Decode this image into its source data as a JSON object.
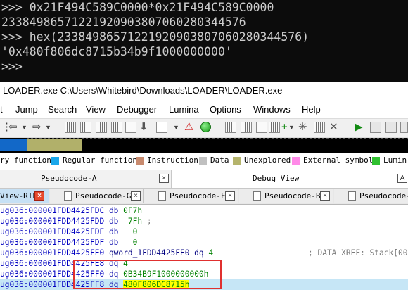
{
  "terminal": {
    "lines": [
      ">>> 0x21F494C589C0000*0x21F494C589C0000",
      "23384986571221920903807060280344576",
      ">>> hex(23384986571221920903807060280344576)",
      "'0x480f806dc8715b34b9f1000000000'",
      ">>>"
    ],
    "bg": "#0c0c0c",
    "fg": "#cccccc"
  },
  "window": {
    "title": "LOADER.exe C:\\Users\\Whitebird\\Downloads\\LOADER\\LOADER.exe"
  },
  "menu": {
    "items": [
      "t",
      "Jump",
      "Search",
      "View",
      "Debugger",
      "Lumina",
      "Options",
      "Windows",
      "Help"
    ]
  },
  "toolbar": {
    "icons": [
      "back-arrow-icon",
      "forward-arrow-icon",
      "hex-view-icon",
      "jump-down-icon",
      "warning-icon",
      "record-icon",
      "step-into-icon",
      "step-over-icon",
      "play-icon",
      "pause-icon",
      "stop-icon"
    ]
  },
  "legend": {
    "items": [
      {
        "label": "ry function",
        "color": "#1fa3d8"
      },
      {
        "label": "Regular function",
        "color": "#1aa7ea"
      },
      {
        "label": "Instruction",
        "color": "#c88a6e"
      },
      {
        "label": "Data",
        "color": "#c0c0c0"
      },
      {
        "label": "Unexplored",
        "color": "#b5b46c"
      },
      {
        "label": "External symbol",
        "color": "#ff8ae8"
      },
      {
        "label": "Lumin",
        "color": "#30c030"
      }
    ]
  },
  "top_tabs": [
    {
      "label": "Pseudocode-A"
    },
    {
      "label": "Debug View"
    }
  ],
  "sub_tabs": [
    {
      "label": "View-RIP"
    },
    {
      "label": "Pseudocode-G"
    },
    {
      "label": "Pseudocode-F"
    },
    {
      "label": "Pseudocode-B"
    },
    {
      "label": "Pseudocode-E"
    }
  ],
  "code": {
    "lines": [
      {
        "addr": "ug036:000001FDD4425FDC",
        "mnem": "db",
        "operand": "0F7h",
        "tail": ""
      },
      {
        "addr": "ug036:000001FDD4425FDD",
        "mnem": "db",
        "operand": " 7Fh",
        "tail": " ;"
      },
      {
        "addr": "ug036:000001FDD4425FDE",
        "mnem": "db",
        "operand": "  0",
        "tail": ""
      },
      {
        "addr": "ug036:000001FDD4425FDF",
        "mnem": "db",
        "operand": "  0",
        "tail": ""
      },
      {
        "addr": "ug036:000001FDD4425FE0",
        "mnem": "qword_1FDD4425FE0 dq",
        "operand": "4",
        "tail": "",
        "comment": "; DATA XREF: Stack[00"
      },
      {
        "addr": "ug036:000001FDD4425FE8",
        "mnem": "dq",
        "operand": "4",
        "tail": ""
      },
      {
        "addr": "ug036:000001FDD4425FF0",
        "mnem": "dq",
        "operand": "0B34B9F1000000000h",
        "tail": ""
      },
      {
        "addr": "ug036:000001FDD4425FF8",
        "mnem": "dq",
        "operand": "480F806DC8715h",
        "tail": ""
      }
    ]
  }
}
